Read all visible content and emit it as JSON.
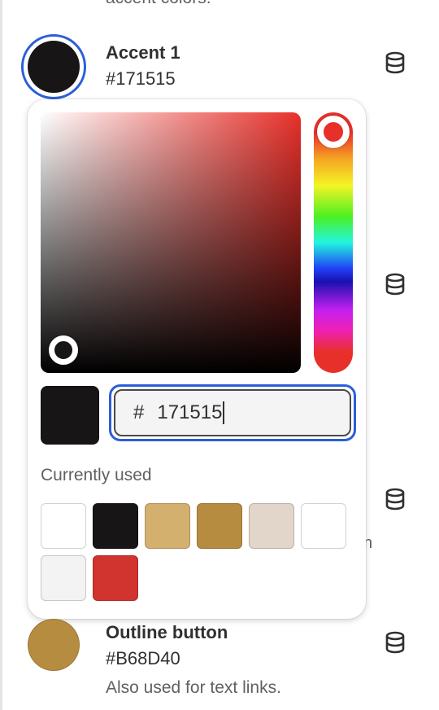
{
  "top_description": "accent colors.",
  "accent1": {
    "title": "Accent 1",
    "hex": "#171515",
    "color": "#171515"
  },
  "picker": {
    "hue_color": "#e8302a",
    "hex_prefix": "#",
    "hex_input_value": "171515",
    "preview_color": "#171515",
    "currently_used_label": "Currently used",
    "used_colors": [
      "#ffffff",
      "#171515",
      "#d4b06f",
      "#b68d40",
      "#e2d6cb",
      "#ffffff",
      "#f3f3f3",
      "#d1332e"
    ]
  },
  "outline_button": {
    "title": "Outline button",
    "hex": "#B68D40",
    "color": "#B68D40",
    "note": "Also used for text links."
  },
  "partial_text": "n",
  "icons": {
    "database": "database-icon"
  }
}
